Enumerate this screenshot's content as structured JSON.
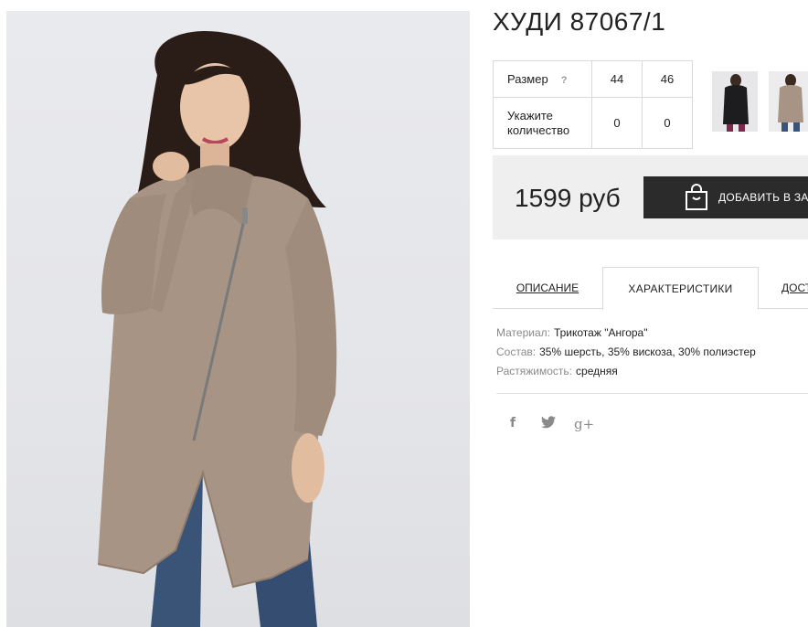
{
  "product": {
    "title": "ХУДИ 87067/1",
    "image_alt": "Model wearing beige-grey knitted asymmetric zip hoodie coat with jeans"
  },
  "size_table": {
    "size_label": "Размер",
    "help_symbol": "?",
    "sizes": [
      "44",
      "46"
    ],
    "quantity_label_line1": "Укажите",
    "quantity_label_line2": "количество",
    "quantities": [
      "0",
      "0"
    ]
  },
  "thumbnails": [
    {
      "name": "black-hoodie"
    },
    {
      "name": "beige-hoodie"
    }
  ],
  "purchase": {
    "price": "1599 руб",
    "add_to_cart_label": "ДОБАВИТЬ В ЗА"
  },
  "tabs": [
    {
      "label": "ОПИСАНИЕ",
      "active": false
    },
    {
      "label": "ХАРАКТЕРИСТИКИ",
      "active": true
    },
    {
      "label": "ДОСТ",
      "active": false
    }
  ],
  "characteristics": [
    {
      "key": "Материал:",
      "value": "Трикотаж \"Ангора\""
    },
    {
      "key": "Состав:",
      "value": "35% шерсть, 35% вискоза, 30% полиэстер"
    },
    {
      "key": "Растяжимость:",
      "value": "средняя"
    }
  ],
  "social": {
    "facebook": "f",
    "twitter_icon": "twitter-bird",
    "google_plus": "g+"
  },
  "colors": {
    "button": "#2b2b2b",
    "price_bar": "#efefef",
    "garment": "#a89484"
  }
}
